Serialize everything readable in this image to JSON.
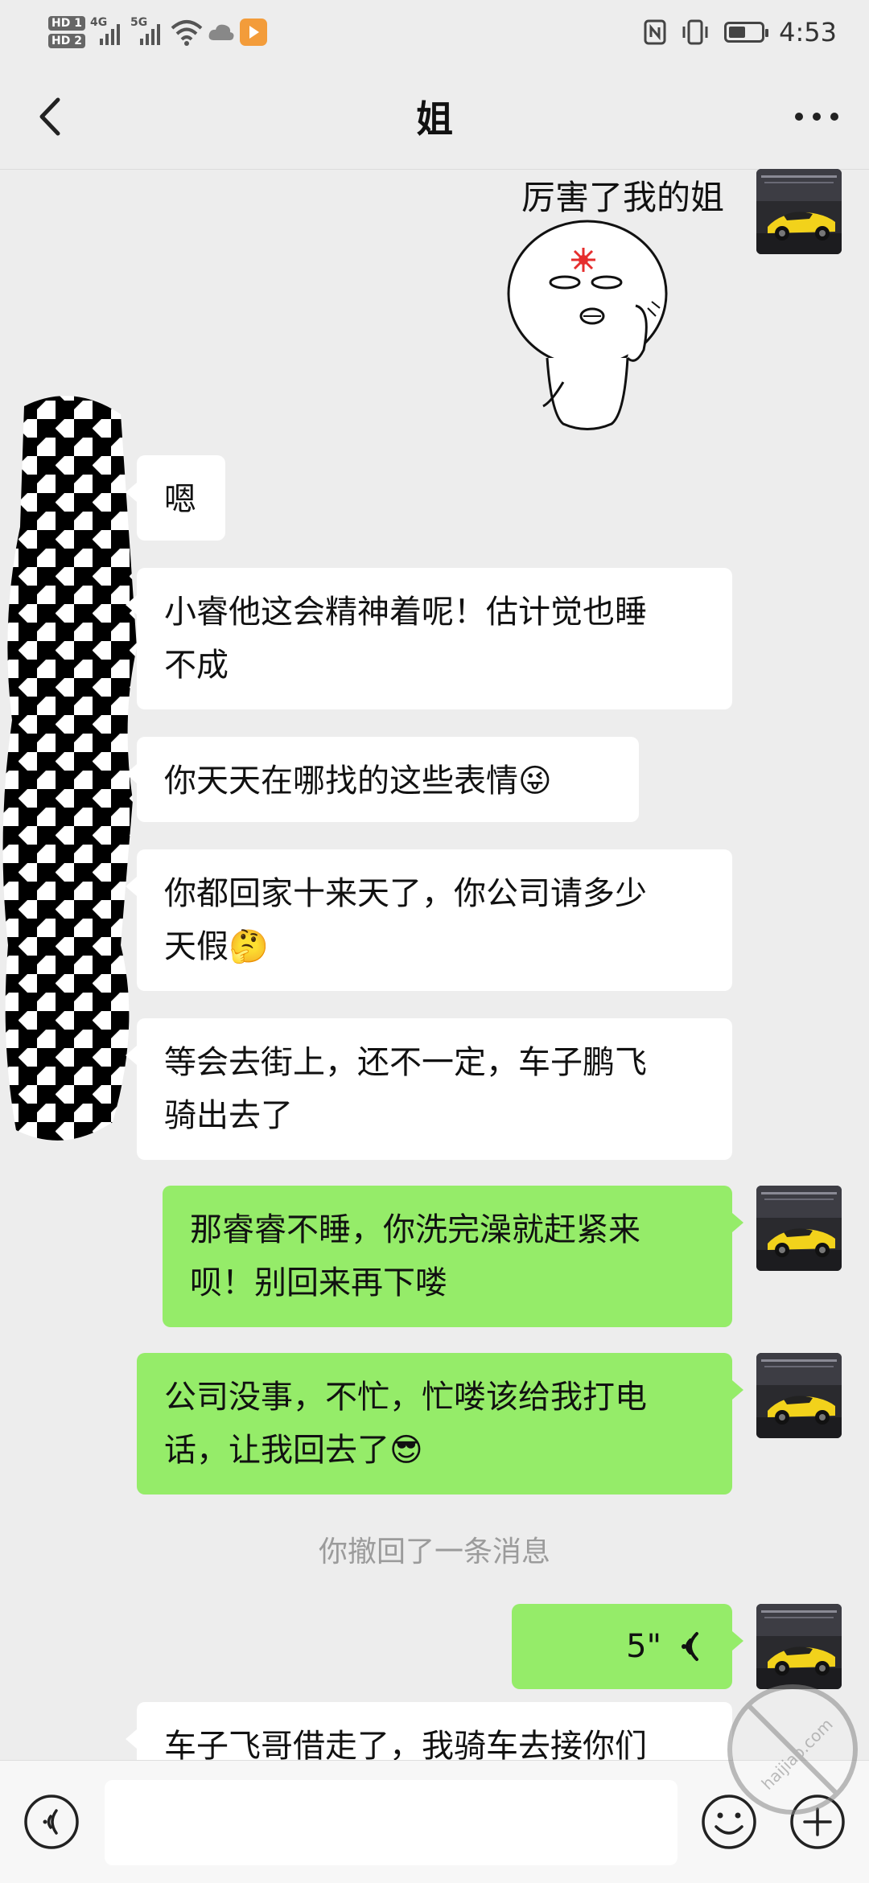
{
  "status_bar": {
    "hd1": "HD 1",
    "hd2": "HD 2",
    "net1": "4G",
    "net2": "5G",
    "time": "4:53"
  },
  "header": {
    "title": "姐"
  },
  "messages": [
    {
      "id": "m1",
      "side": "out",
      "type": "sticker",
      "text": "厉害了我的姐"
    },
    {
      "id": "m2",
      "side": "in",
      "type": "text",
      "text": "嗯"
    },
    {
      "id": "m3",
      "side": "in",
      "type": "text",
      "line1": "小睿他这会精神着呢！估计觉也睡",
      "line2": "不成"
    },
    {
      "id": "m4",
      "side": "in",
      "type": "text",
      "text": "你天天在哪找的这些表情",
      "emoji": "😜"
    },
    {
      "id": "m5",
      "side": "in",
      "type": "text",
      "line1": "你都回家十来天了，你公司请多少",
      "line2": "天假",
      "emoji": "🤔"
    },
    {
      "id": "m6",
      "side": "in",
      "type": "text",
      "line1": "等会去街上，还不一定，车子鹏飞",
      "line2": "骑出去了"
    },
    {
      "id": "m7",
      "side": "out",
      "type": "text",
      "line1": "那睿睿不睡，你洗完澡就赶紧来",
      "line2": "呗！别回来再下喽"
    },
    {
      "id": "m8",
      "side": "out",
      "type": "text",
      "line1": "公司没事，不忙，忙喽该给我打电",
      "line2": "话，让我回去了",
      "emoji": "😎"
    },
    {
      "id": "m9",
      "side": "system",
      "type": "system",
      "text": "你撤回了一条消息"
    },
    {
      "id": "m10",
      "side": "out",
      "type": "voice",
      "duration": "5\""
    },
    {
      "id": "m11",
      "side": "in",
      "type": "text",
      "text": "车子飞哥借走了，我骑车去接你们"
    }
  ],
  "watermark": "haijiao.com",
  "colors": {
    "chat_bg": "#ededed",
    "incoming_bubble": "#ffffff",
    "outgoing_bubble": "#95ec69",
    "system_text": "#9b9b9b",
    "avatar_car": "#f2d21b"
  },
  "icons": {
    "back": "back-arrow-icon",
    "more": "more-dots-icon",
    "voice_input": "voice-input-icon",
    "emoji": "emoji-icon",
    "plus": "plus-icon"
  }
}
